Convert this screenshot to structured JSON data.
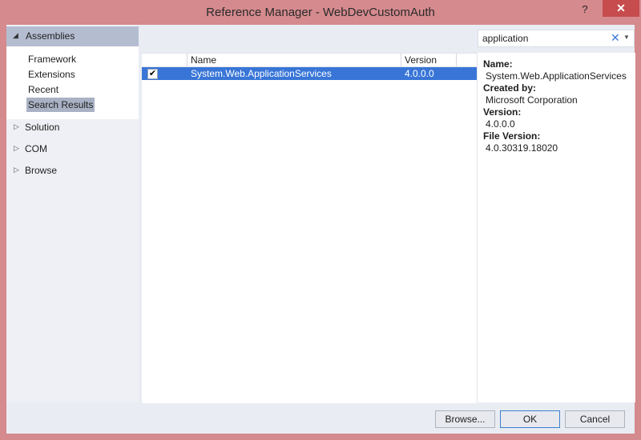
{
  "window": {
    "title": "Reference Manager - WebDevCustomAuth",
    "help_label": "?",
    "close_label": "✕"
  },
  "nav": {
    "assemblies_label": "Assemblies",
    "sub_items": [
      {
        "label": "Framework"
      },
      {
        "label": "Extensions"
      },
      {
        "label": "Recent"
      },
      {
        "label": "Search Results",
        "selected": true
      }
    ],
    "sections": [
      {
        "label": "Solution"
      },
      {
        "label": "COM"
      },
      {
        "label": "Browse"
      }
    ]
  },
  "search": {
    "value": "application"
  },
  "list": {
    "columns": [
      "Name",
      "Version"
    ],
    "rows": [
      {
        "checked": true,
        "name": "System.Web.ApplicationServices",
        "version": "4.0.0.0",
        "selected": true
      }
    ]
  },
  "details": {
    "name_label": "Name:",
    "name_value": "System.Web.ApplicationServices",
    "created_by_label": "Created by:",
    "created_by_value": "Microsoft Corporation",
    "version_label": "Version:",
    "version_value": "4.0.0.0",
    "file_version_label": "File Version:",
    "file_version_value": "4.0.30319.18020"
  },
  "buttons": {
    "browse": "Browse...",
    "ok": "OK",
    "cancel": "Cancel"
  },
  "colors": {
    "window_frame": "#d58a8e",
    "close_button": "#c74c4d",
    "selection": "#3875d7",
    "nav_selected": "#b4bdd0"
  }
}
